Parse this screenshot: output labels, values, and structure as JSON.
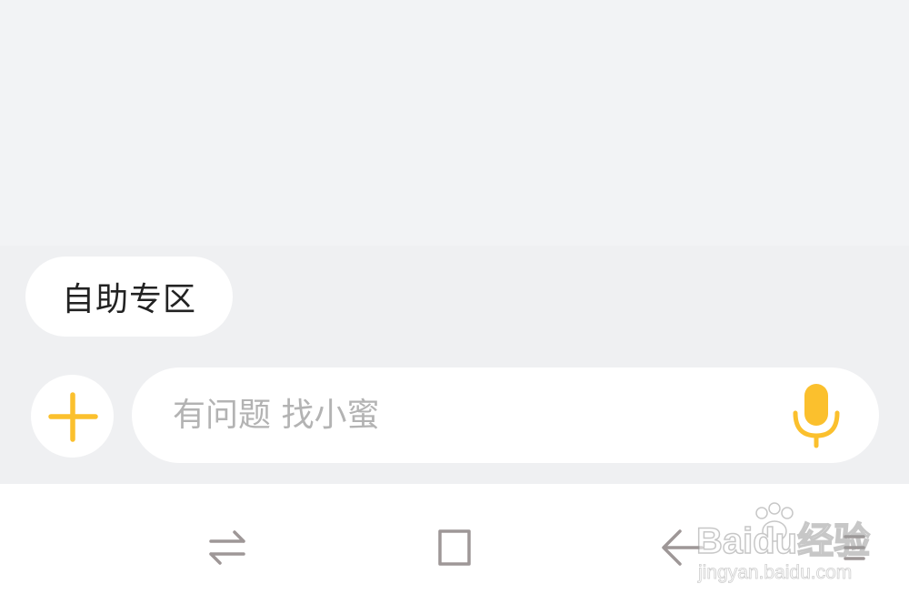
{
  "quick_chip": {
    "label": "自助专区"
  },
  "composer": {
    "placeholder": "有问题 找小蜜",
    "icons": {
      "add": "plus-icon",
      "voice": "microphone-icon"
    },
    "accent_color": "#fbc02d"
  },
  "nav_bar": {
    "icons": [
      "switch-arrows-icon",
      "home-square-icon",
      "back-arrow-icon",
      "menu-icon"
    ],
    "icon_color": "#9e9797"
  },
  "watermark": {
    "brand": "Baidu经验",
    "url": "jingyan.baidu.com"
  }
}
